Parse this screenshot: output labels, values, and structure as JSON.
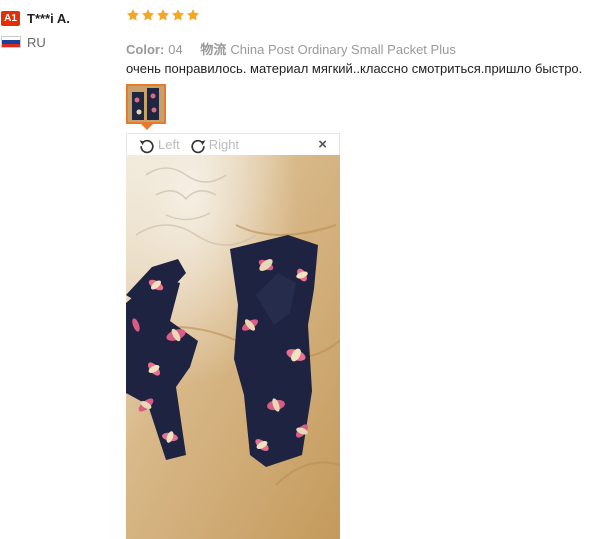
{
  "user": {
    "badge": "A1",
    "name": "T***i A.",
    "country": "RU",
    "flag_colors": [
      "#ffffff",
      "#1c3f9c",
      "#d52b1e"
    ]
  },
  "review": {
    "stars": 5,
    "star_color": "#f5a623",
    "color_label": "Color:",
    "color_value": "04",
    "shipping_label": "物流",
    "shipping_value": "China Post Ordinary Small Packet Plus",
    "feedback": "очень понравилось. материал мягкий..классно смотриться.пришло быстро."
  },
  "viewer": {
    "rotate_left_label": "Left",
    "rotate_right_label": "Right",
    "close_label": "×",
    "photo_icon": "product-photo-headbands"
  },
  "colors": {
    "accent": "#e77a2e",
    "badge_bg": "#e62e04"
  }
}
